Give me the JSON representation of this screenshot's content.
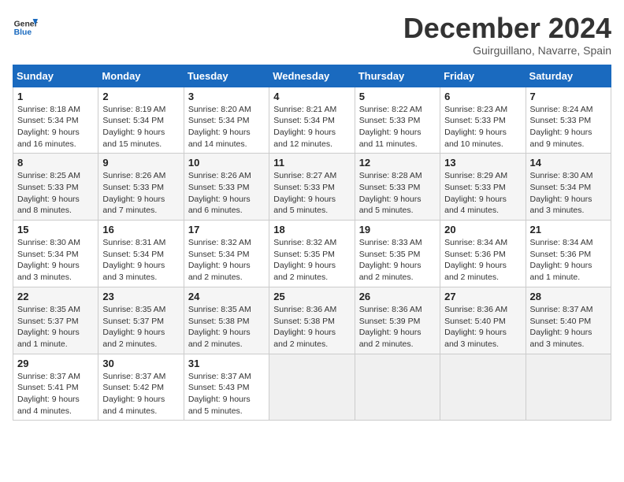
{
  "header": {
    "logo_line1": "General",
    "logo_line2": "Blue",
    "month": "December 2024",
    "location": "Guirguillano, Navarre, Spain"
  },
  "weekdays": [
    "Sunday",
    "Monday",
    "Tuesday",
    "Wednesday",
    "Thursday",
    "Friday",
    "Saturday"
  ],
  "weeks": [
    [
      {
        "day": "1",
        "info": "Sunrise: 8:18 AM\nSunset: 5:34 PM\nDaylight: 9 hours and 16 minutes."
      },
      {
        "day": "2",
        "info": "Sunrise: 8:19 AM\nSunset: 5:34 PM\nDaylight: 9 hours and 15 minutes."
      },
      {
        "day": "3",
        "info": "Sunrise: 8:20 AM\nSunset: 5:34 PM\nDaylight: 9 hours and 14 minutes."
      },
      {
        "day": "4",
        "info": "Sunrise: 8:21 AM\nSunset: 5:34 PM\nDaylight: 9 hours and 12 minutes."
      },
      {
        "day": "5",
        "info": "Sunrise: 8:22 AM\nSunset: 5:33 PM\nDaylight: 9 hours and 11 minutes."
      },
      {
        "day": "6",
        "info": "Sunrise: 8:23 AM\nSunset: 5:33 PM\nDaylight: 9 hours and 10 minutes."
      },
      {
        "day": "7",
        "info": "Sunrise: 8:24 AM\nSunset: 5:33 PM\nDaylight: 9 hours and 9 minutes."
      }
    ],
    [
      {
        "day": "8",
        "info": "Sunrise: 8:25 AM\nSunset: 5:33 PM\nDaylight: 9 hours and 8 minutes."
      },
      {
        "day": "9",
        "info": "Sunrise: 8:26 AM\nSunset: 5:33 PM\nDaylight: 9 hours and 7 minutes."
      },
      {
        "day": "10",
        "info": "Sunrise: 8:26 AM\nSunset: 5:33 PM\nDaylight: 9 hours and 6 minutes."
      },
      {
        "day": "11",
        "info": "Sunrise: 8:27 AM\nSunset: 5:33 PM\nDaylight: 9 hours and 5 minutes."
      },
      {
        "day": "12",
        "info": "Sunrise: 8:28 AM\nSunset: 5:33 PM\nDaylight: 9 hours and 5 minutes."
      },
      {
        "day": "13",
        "info": "Sunrise: 8:29 AM\nSunset: 5:33 PM\nDaylight: 9 hours and 4 minutes."
      },
      {
        "day": "14",
        "info": "Sunrise: 8:30 AM\nSunset: 5:34 PM\nDaylight: 9 hours and 3 minutes."
      }
    ],
    [
      {
        "day": "15",
        "info": "Sunrise: 8:30 AM\nSunset: 5:34 PM\nDaylight: 9 hours and 3 minutes."
      },
      {
        "day": "16",
        "info": "Sunrise: 8:31 AM\nSunset: 5:34 PM\nDaylight: 9 hours and 3 minutes."
      },
      {
        "day": "17",
        "info": "Sunrise: 8:32 AM\nSunset: 5:34 PM\nDaylight: 9 hours and 2 minutes."
      },
      {
        "day": "18",
        "info": "Sunrise: 8:32 AM\nSunset: 5:35 PM\nDaylight: 9 hours and 2 minutes."
      },
      {
        "day": "19",
        "info": "Sunrise: 8:33 AM\nSunset: 5:35 PM\nDaylight: 9 hours and 2 minutes."
      },
      {
        "day": "20",
        "info": "Sunrise: 8:34 AM\nSunset: 5:36 PM\nDaylight: 9 hours and 2 minutes."
      },
      {
        "day": "21",
        "info": "Sunrise: 8:34 AM\nSunset: 5:36 PM\nDaylight: 9 hours and 1 minute."
      }
    ],
    [
      {
        "day": "22",
        "info": "Sunrise: 8:35 AM\nSunset: 5:37 PM\nDaylight: 9 hours and 1 minute."
      },
      {
        "day": "23",
        "info": "Sunrise: 8:35 AM\nSunset: 5:37 PM\nDaylight: 9 hours and 2 minutes."
      },
      {
        "day": "24",
        "info": "Sunrise: 8:35 AM\nSunset: 5:38 PM\nDaylight: 9 hours and 2 minutes."
      },
      {
        "day": "25",
        "info": "Sunrise: 8:36 AM\nSunset: 5:38 PM\nDaylight: 9 hours and 2 minutes."
      },
      {
        "day": "26",
        "info": "Sunrise: 8:36 AM\nSunset: 5:39 PM\nDaylight: 9 hours and 2 minutes."
      },
      {
        "day": "27",
        "info": "Sunrise: 8:36 AM\nSunset: 5:40 PM\nDaylight: 9 hours and 3 minutes."
      },
      {
        "day": "28",
        "info": "Sunrise: 8:37 AM\nSunset: 5:40 PM\nDaylight: 9 hours and 3 minutes."
      }
    ],
    [
      {
        "day": "29",
        "info": "Sunrise: 8:37 AM\nSunset: 5:41 PM\nDaylight: 9 hours and 4 minutes."
      },
      {
        "day": "30",
        "info": "Sunrise: 8:37 AM\nSunset: 5:42 PM\nDaylight: 9 hours and 4 minutes."
      },
      {
        "day": "31",
        "info": "Sunrise: 8:37 AM\nSunset: 5:43 PM\nDaylight: 9 hours and 5 minutes."
      },
      {
        "day": "",
        "info": ""
      },
      {
        "day": "",
        "info": ""
      },
      {
        "day": "",
        "info": ""
      },
      {
        "day": "",
        "info": ""
      }
    ]
  ]
}
